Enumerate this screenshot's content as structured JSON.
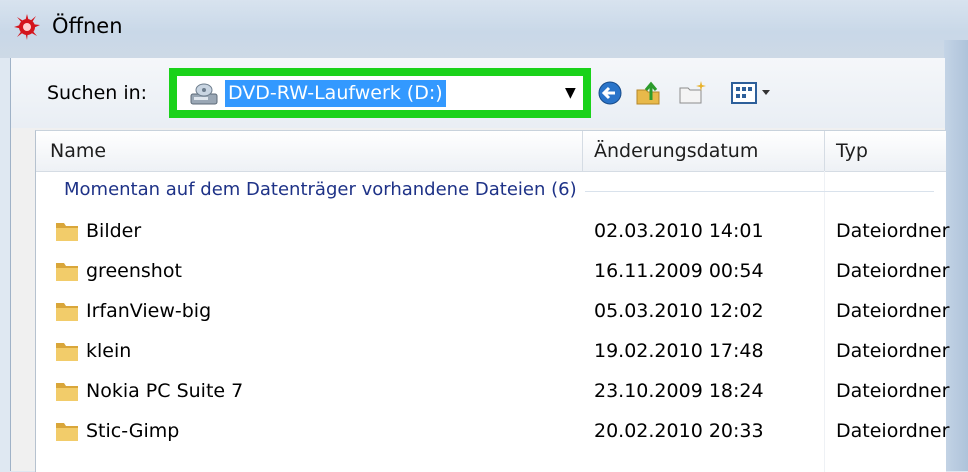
{
  "window": {
    "title": "Öffnen"
  },
  "toolbar": {
    "look_in_label": "Suchen in:",
    "look_in_value": "DVD-RW-Laufwerk (D:)",
    "highlight_color": "#1ad21a",
    "icons": [
      "drive-icon",
      "back-icon",
      "up-folder-icon",
      "new-folder-icon",
      "views-menu-icon"
    ]
  },
  "columns": {
    "name": "Name",
    "date": "Änderungsdatum",
    "type": "Typ"
  },
  "group": {
    "label": "Momentan auf dem Datenträger vorhandene Dateien (6)"
  },
  "files": [
    {
      "name": "Bilder",
      "date": "02.03.2010 14:01",
      "type": "Dateiordner",
      "icon": "folder-icon"
    },
    {
      "name": "greenshot",
      "date": "16.11.2009 00:54",
      "type": "Dateiordner",
      "icon": "folder-icon"
    },
    {
      "name": "IrfanView-big",
      "date": "05.03.2010 12:02",
      "type": "Dateiordner",
      "icon": "folder-icon"
    },
    {
      "name": "klein",
      "date": "19.02.2010 17:48",
      "type": "Dateiordner",
      "icon": "folder-icon"
    },
    {
      "name": "Nokia PC Suite 7",
      "date": "23.10.2009 18:24",
      "type": "Dateiordner",
      "icon": "folder-icon"
    },
    {
      "name": "Stic-Gimp",
      "date": "20.02.2010 20:33",
      "type": "Dateiordner",
      "icon": "folder-icon"
    }
  ]
}
